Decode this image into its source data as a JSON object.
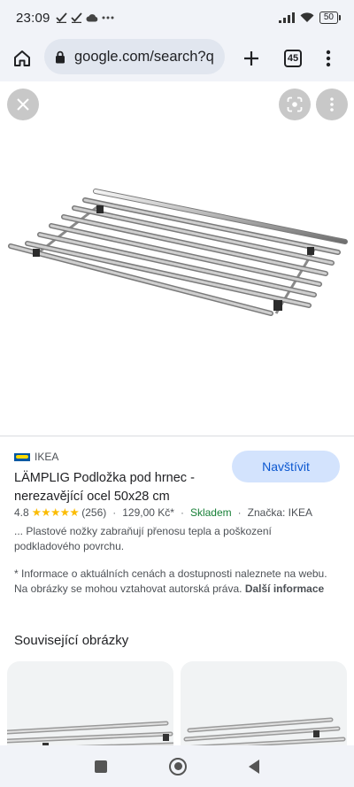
{
  "status_bar": {
    "time": "23:09",
    "left_icons": [
      "check-icon",
      "check-icon",
      "cloud-icon",
      "more-icon"
    ],
    "battery": "50"
  },
  "browser": {
    "url": "google.com/search?q",
    "tab_count": "45"
  },
  "product": {
    "source": "IKEA",
    "visit_label": "Navštívit",
    "title": "LÄMPLIG Podložka pod hrnec - nerezavějící ocel 50x28 cm",
    "rating": "4.8",
    "stars": "★★★★★",
    "reviews": "(256)",
    "price": "129,00 Kč*",
    "availability": "Skladem",
    "brand": "Značka: IKEA",
    "description": "... Plastové nožky zabraňují přenosu tepla a poškození podkladového povrchu.",
    "note": "* Informace o aktuálních cenách a dostupnosti naleznete na webu. Na obrázky se mohou vztahovat autorská práva.",
    "note_more": "Další informace"
  },
  "related": {
    "title": "Související obrázky"
  },
  "colors": {
    "accent": "#0b57d0",
    "visit_bg": "#d3e3fd",
    "stock_green": "#188038",
    "star": "#fbbc04"
  }
}
